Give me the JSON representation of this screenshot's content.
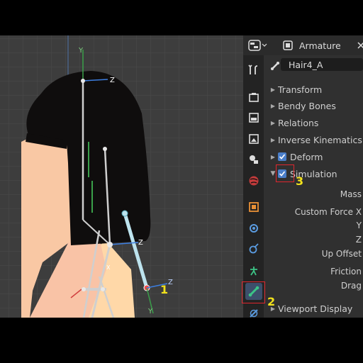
{
  "header": {
    "object_type": "Armature",
    "bone_name": "Hair4_A"
  },
  "panels": [
    {
      "label": "Transform",
      "expanded": false
    },
    {
      "label": "Bendy Bones",
      "expanded": false
    },
    {
      "label": "Relations",
      "expanded": false
    },
    {
      "label": "Inverse Kinematics",
      "expanded": false
    },
    {
      "label": "Deform",
      "expanded": false,
      "checkbox": true
    },
    {
      "label": "Simulation",
      "expanded": true,
      "checkbox": true
    }
  ],
  "simulation_fields": [
    "Mass",
    "Custom Force X",
    "Y",
    "Z",
    "Up Offset",
    "Friction",
    "Drag"
  ],
  "footer_panel": {
    "label": "Viewport Display",
    "expanded": false
  },
  "viewport": {
    "axis_labels": {
      "y_top": "Y",
      "z_top": "Z",
      "z_mid": "Z",
      "z_bottom": "Z",
      "y_bottom": "Y",
      "x_small": "X"
    }
  },
  "annotations": {
    "marker1": "1",
    "marker2": "2",
    "marker3": "3",
    "color": "#e0262e",
    "marker_color": "#f1e11c"
  },
  "icons": [
    "tool-icon",
    "render-icon",
    "output-icon",
    "view-layer-icon",
    "scene-icon",
    "world-icon",
    "object-icon",
    "modifier-icon",
    "particles-icon",
    "physics-icon",
    "bone-icon",
    "bone-constraint-icon"
  ],
  "colors": {
    "accent": "#4a7ec9",
    "viewport_bg": "#3d3d3d",
    "panel_bg": "#303030"
  }
}
